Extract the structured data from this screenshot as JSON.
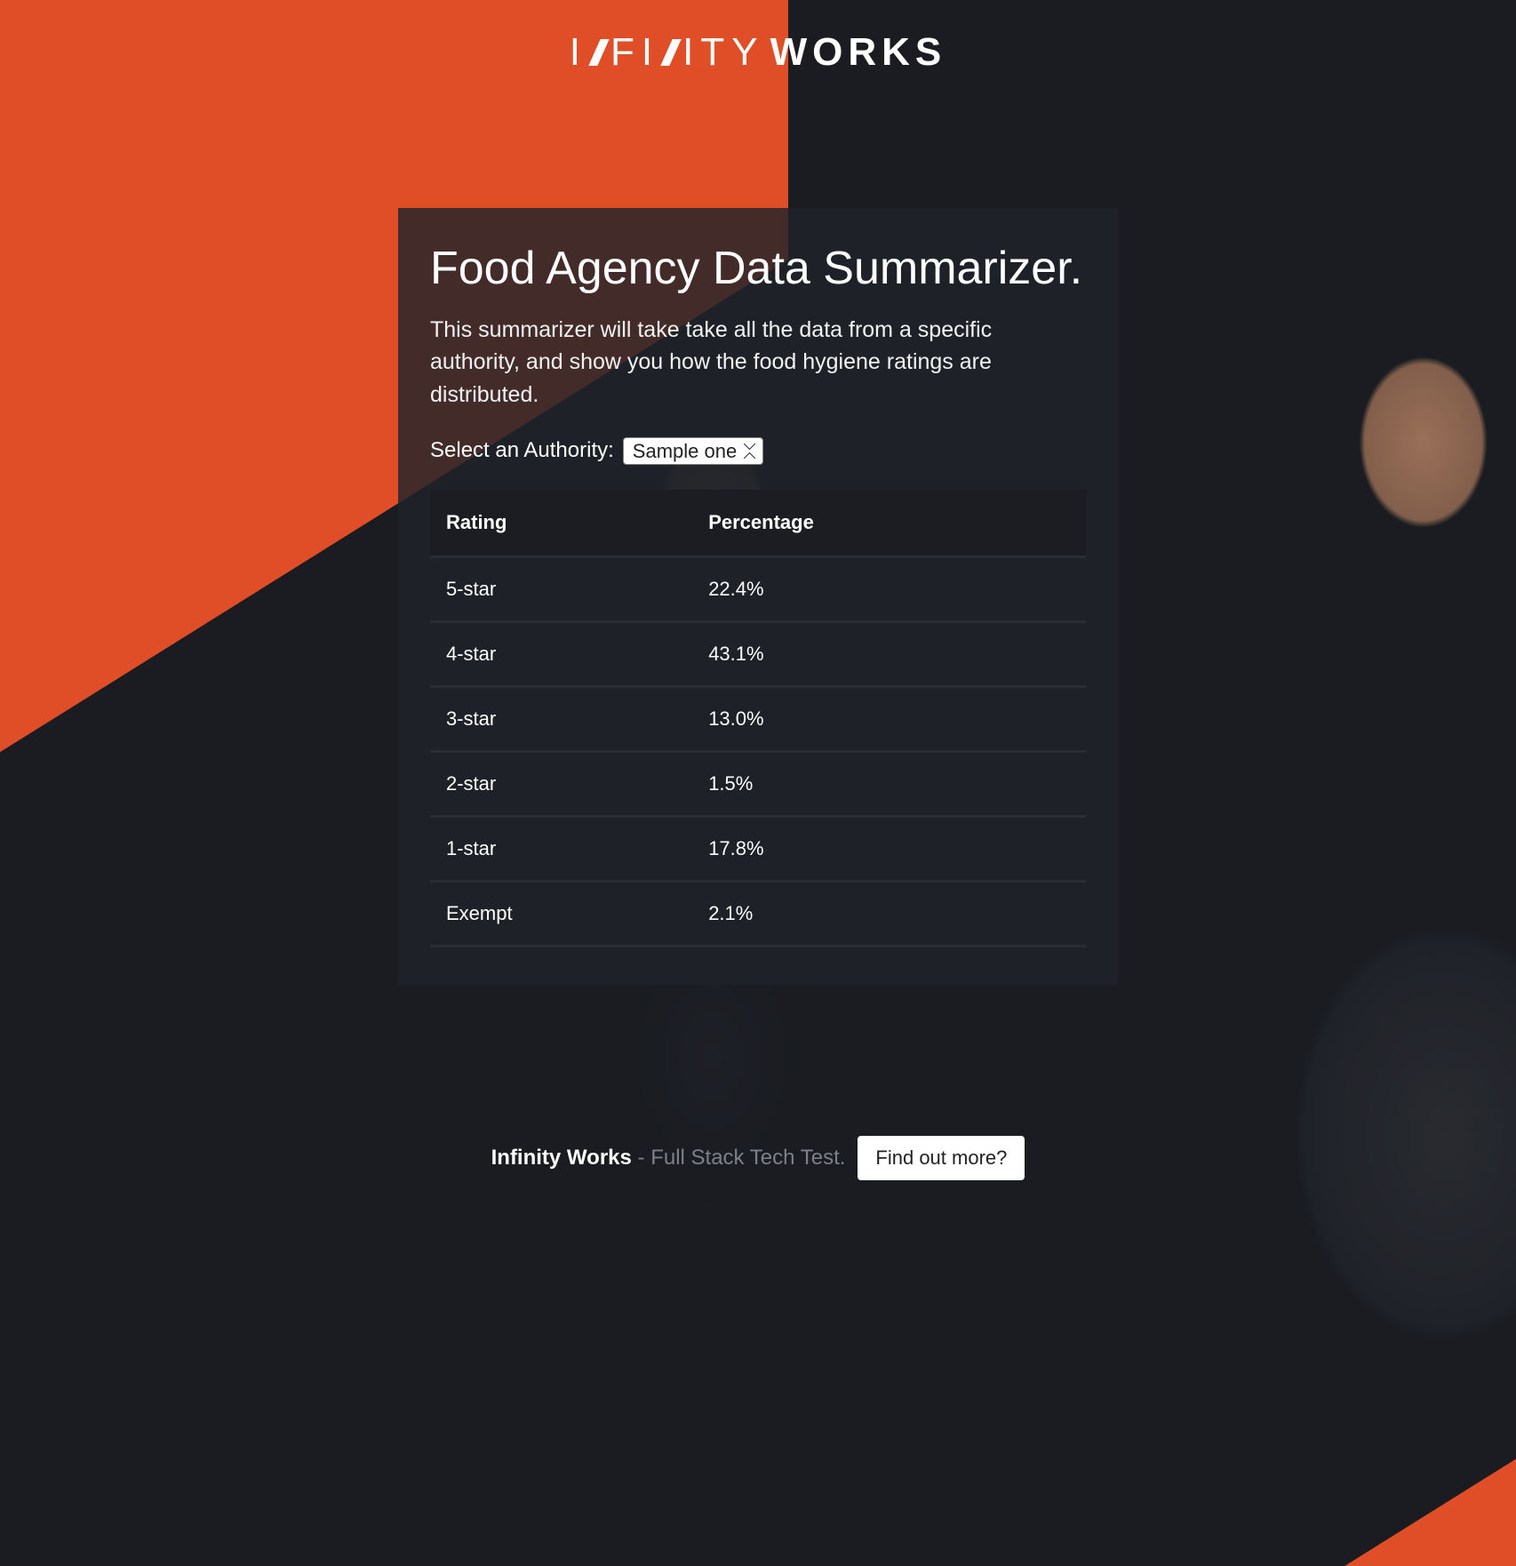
{
  "brand": {
    "word1": "I",
    "word2": "FI",
    "word3": "ITY",
    "word4": "WORKS"
  },
  "card": {
    "title": "Food Agency Data Summarizer.",
    "subtitle": "This summarizer will take take all the data from a specific authority, and show you how the food hygiene ratings are distributed.",
    "select_label": "Select an Authority:",
    "select_value": "Sample one"
  },
  "table": {
    "headers": {
      "col1": "Rating",
      "col2": "Percentage"
    },
    "rows": [
      {
        "rating": "5-star",
        "pct": "22.4%"
      },
      {
        "rating": "4-star",
        "pct": "43.1%"
      },
      {
        "rating": "3-star",
        "pct": "13.0%"
      },
      {
        "rating": "2-star",
        "pct": "1.5%"
      },
      {
        "rating": "1-star",
        "pct": "17.8%"
      },
      {
        "rating": "Exempt",
        "pct": "2.1%"
      }
    ]
  },
  "footer": {
    "brand": "Infinity Works",
    "tagline": " - Full Stack Tech Test.",
    "cta": "Find out more?"
  }
}
